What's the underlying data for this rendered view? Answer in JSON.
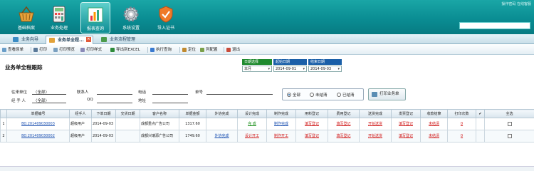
{
  "header": {
    "top_links": "操作密码  在线客服",
    "nav": [
      {
        "label": "基础档案",
        "icon": "basket-icon"
      },
      {
        "label": "业务处理",
        "icon": "calculator-icon"
      },
      {
        "label": "报表查询",
        "icon": "bar-chart-icon"
      },
      {
        "label": "系统设置",
        "icon": "gear-icon"
      },
      {
        "label": "导入证书",
        "icon": "shield-check-icon"
      }
    ],
    "active_nav": "报表查询"
  },
  "tabs": [
    {
      "label": "业务向导",
      "selected": false
    },
    {
      "label": "业务单全程...",
      "selected": true
    },
    {
      "label": "业务流程管理",
      "selected": false
    }
  ],
  "toolbar": [
    "查看原单",
    "打印",
    "打印预览",
    "打印样式",
    "导出到EXCEL",
    "执行查询",
    "定位",
    "列配置",
    "退出"
  ],
  "page": {
    "title": "业务单全程跟踪",
    "date_select_label": "日期选择",
    "date_select_value": "本月",
    "start_label": "起始日期",
    "start_value": "2014-09-01",
    "end_label": "结束日期",
    "end_value": "2014-09-03"
  },
  "filters": {
    "customer_label": "往来单位",
    "customer_value": "〈全部〉",
    "handler_label": "经 手 人",
    "handler_value": "〈全部〉",
    "contact_label": "联系人",
    "qq_label": "QQ",
    "phone_label": "电话",
    "address_label": "地址",
    "number_label": "单号",
    "radio_all": "全部",
    "radio_unsettled": "未结清",
    "radio_settled": "已结清",
    "print_button": "打印业务单"
  },
  "grid": {
    "columns": [
      "",
      "单据编号",
      "经手人",
      "下单日期",
      "交货日期",
      "客户名称",
      "单据金额",
      "外协完成",
      "设计完成",
      "制作完成",
      "用料登记",
      "费用登记",
      "送货完成",
      "发票登记",
      "收款结算",
      "打印次数",
      "✔",
      "全选"
    ],
    "rows": [
      {
        "idx": "1",
        "no": "BO.201409030003",
        "handler": "超级用户",
        "order_date": "2014-09-03",
        "delivery": "",
        "customer": "成都重点广告公司",
        "amount": "1317.60",
        "outsource": "",
        "design": "完 成",
        "make": "制作完成",
        "material": "填写登记",
        "cost": "填写登记",
        "deliver": "开始送货",
        "invoice": "填写登记",
        "payment": "未结清",
        "prints": "0"
      },
      {
        "idx": "2",
        "no": "BO.201409030002",
        "handler": "超级用户",
        "order_date": "2014-09-03",
        "delivery": "",
        "customer": "成都兴瑞源广告公司",
        "amount": "1749.60",
        "outsource": "外协完成",
        "design": "设计开工",
        "make": "制作开工",
        "material": "填写登记",
        "cost": "填写登记",
        "deliver": "开始送货",
        "invoice": "填写登记",
        "payment": "未结清",
        "prints": "0"
      }
    ]
  },
  "colors": {
    "banner": "#0a8d93",
    "date_head_green": "#1f8a2e",
    "date_head_blue": "#1a5fa8",
    "link_red": "#d01818",
    "link_blue": "#1a4fb0"
  }
}
